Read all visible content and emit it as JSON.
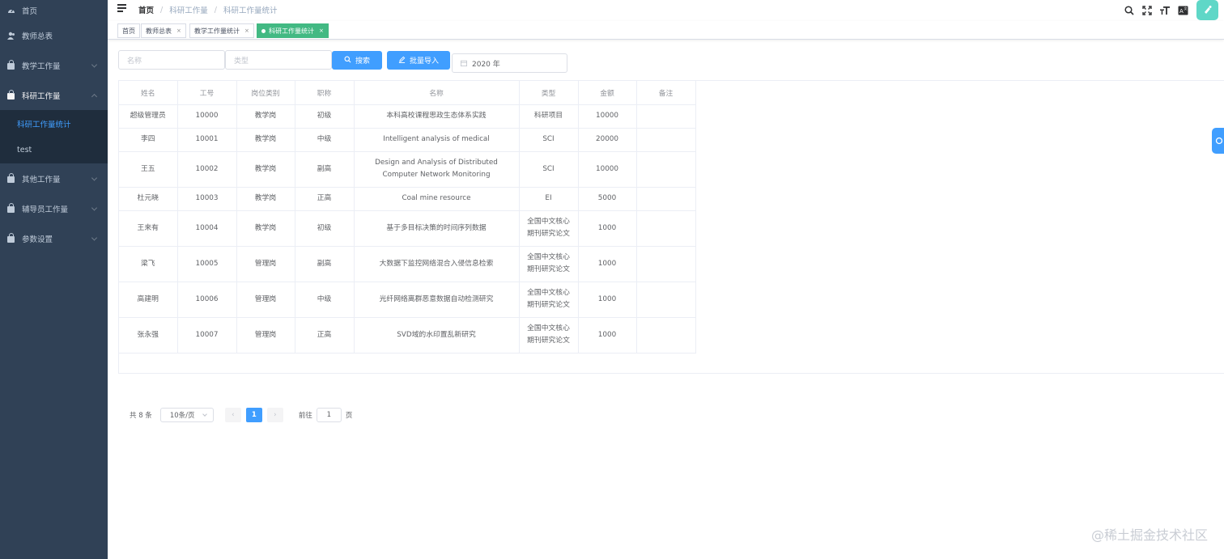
{
  "sidebar": {
    "items": [
      {
        "label": "首页",
        "icon": "dashboard-icon"
      },
      {
        "label": "教师总表",
        "icon": "user-icon"
      },
      {
        "label": "教学工作量",
        "icon": "lock-icon"
      },
      {
        "label": "科研工作量",
        "icon": "lock-icon",
        "expanded": true,
        "children": [
          {
            "label": "科研工作量统计",
            "active": true
          },
          {
            "label": "test"
          }
        ]
      },
      {
        "label": "其他工作量",
        "icon": "lock-icon"
      },
      {
        "label": "辅导员工作量",
        "icon": "lock-icon"
      },
      {
        "label": "参数设置",
        "icon": "lock-icon"
      }
    ]
  },
  "navbar": {
    "breadcrumb": [
      "首页",
      "科研工作量",
      "科研工作量统计"
    ],
    "tools": [
      "search-icon",
      "fullscreen-icon",
      "font-size-icon",
      "language-icon"
    ]
  },
  "tags": [
    {
      "label": "首页"
    },
    {
      "label": "教师总表"
    },
    {
      "label": "教学工作量统计"
    },
    {
      "label": "科研工作量统计",
      "active": true
    }
  ],
  "filters": {
    "name_placeholder": "名称",
    "type_placeholder": "类型",
    "search_label": "搜索",
    "import_label": "批量导入",
    "year_value": "2020 年"
  },
  "table": {
    "headers": [
      "姓名",
      "工号",
      "岗位类别",
      "职称",
      "名称",
      "类型",
      "金额",
      "备注"
    ],
    "rows": [
      [
        "超级管理员",
        "10000",
        "教学岗",
        "初级",
        "本科高校课程思政生态体系实践",
        "科研项目",
        "10000",
        ""
      ],
      [
        "李四",
        "10001",
        "教学岗",
        "中级",
        "Intelligent analysis of medical",
        "SCI",
        "20000",
        ""
      ],
      [
        "王五",
        "10002",
        "教学岗",
        "副高",
        "Design and Analysis of Distributed Computer Network Monitoring",
        "SCI",
        "10000",
        ""
      ],
      [
        "杜元晓",
        "10003",
        "教学岗",
        "正高",
        "Coal mine resource",
        "EI",
        "5000",
        ""
      ],
      [
        "王来有",
        "10004",
        "教学岗",
        "初级",
        "基于多目标决策的时间序列数据",
        "全国中文核心期刊研究论文",
        "1000",
        ""
      ],
      [
        "梁飞",
        "10005",
        "管理岗",
        "副高",
        "大数据下监控网络混合入侵信息检索",
        "全国中文核心期刊研究论文",
        "1000",
        ""
      ],
      [
        "高建明",
        "10006",
        "管理岗",
        "中级",
        "光纤网络离群恶意数据自动检测研究",
        "全国中文核心期刊研究论文",
        "1000",
        ""
      ],
      [
        "张永强",
        "10007",
        "管理岗",
        "正高",
        "SVD域的水印置乱新研究",
        "全国中文核心期刊研究论文",
        "1000",
        ""
      ]
    ]
  },
  "pagination": {
    "total_text": "共 8 条",
    "page_size": "10条/页",
    "current_page": "1",
    "goto_prefix": "前往",
    "goto_value": "1",
    "goto_suffix": "页"
  },
  "watermark": "@稀土掘金技术社区",
  "colors": {
    "sidebar_bg": "#304156",
    "primary": "#409eff",
    "active_tag": "#42b983"
  }
}
